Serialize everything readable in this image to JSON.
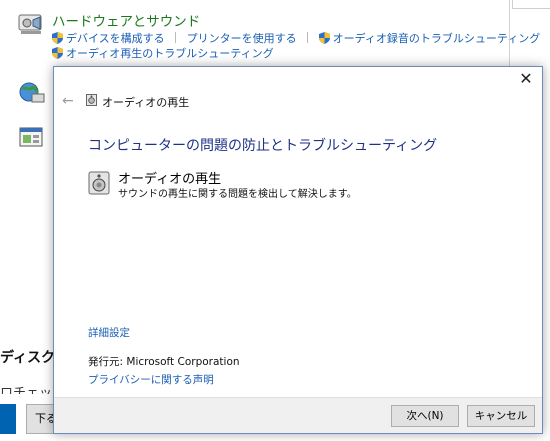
{
  "control_panel": {
    "section_title": "ハードウェアとサウンド",
    "links_row1": [
      "デバイスを構成する",
      "プリンターを使用する",
      "オーディオ録音のトラブルシューティング"
    ],
    "links_row2": [
      "オーディオ再生のトラブルシューティング"
    ],
    "cut_heading": "ディスク",
    "cut_text": "ロチェック",
    "cut_button": "下る",
    "icons": [
      "hardware-sound-icon",
      "network-icon",
      "programs-icon"
    ]
  },
  "dialog": {
    "title": "オーディオの再生",
    "heading": "コンピューターの問題の防止とトラブルシューティング",
    "item_title": "オーディオの再生",
    "item_description": "サウンドの再生に関する問題を検出して解決します。",
    "advanced_link": "詳細設定",
    "publisher_label": "発行元:",
    "publisher_value": "Microsoft Corporation",
    "privacy_link": "プライバシーに関する声明",
    "next_button": "次へ(N)",
    "cancel_button": "キャンセル",
    "close_symbol": "✕",
    "back_symbol": "←"
  },
  "colors": {
    "heading_green": "#1a7a1a",
    "link_blue": "#1a5fb4",
    "dialog_heading": "#1e3287"
  }
}
